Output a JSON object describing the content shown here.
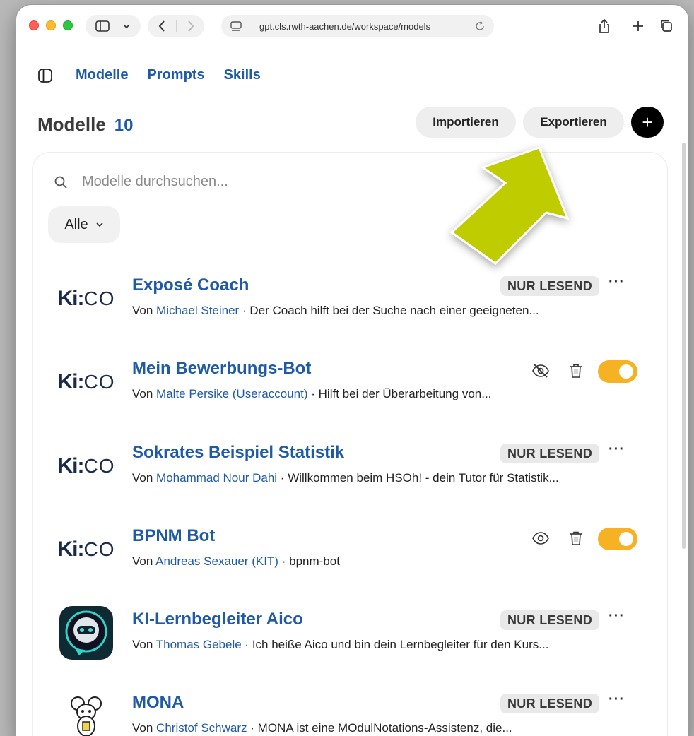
{
  "browser": {
    "url": "gpt.cls.rwth-aachen.de/workspace/models"
  },
  "tabs": [
    {
      "label": "Modelle"
    },
    {
      "label": "Prompts"
    },
    {
      "label": "Skills"
    }
  ],
  "header": {
    "title": "Modelle",
    "count": "10",
    "import_label": "Importieren",
    "export_label": "Exportieren",
    "add_label": "+"
  },
  "search": {
    "placeholder": "Modelle durchsuchen..."
  },
  "filter": {
    "selected": "Alle"
  },
  "models": [
    {
      "name": "Exposé Coach",
      "by": "Von",
      "author": "Michael Steiner",
      "sep": "·",
      "description": "Der Coach hilft bei der Suche nach einer geeigneten...",
      "badge": "NUR LESEND",
      "logo": "kico-logo"
    },
    {
      "name": "Mein Bewerbungs-Bot",
      "by": "Von",
      "author": "Malte Persike (Useraccount)",
      "sep": "·",
      "description": "Hilft bei der Überarbeitung von...",
      "logo": "kico-logo",
      "visibility_icon": "eye-slash-icon",
      "enabled": true
    },
    {
      "name": "Sokrates Beispiel Statistik",
      "by": "Von",
      "author": "Mohammad Nour Dahi",
      "sep": "·",
      "description": "Willkommen beim HSOh! - dein Tutor für Statistik...",
      "badge": "NUR LESEND",
      "logo": "kico-logo"
    },
    {
      "name": "BPNM Bot",
      "by": "Von",
      "author": "Andreas Sexauer (KIT)",
      "sep": "·",
      "description": "bpnm-bot",
      "logo": "kico-logo",
      "visibility_icon": "eye-icon",
      "enabled": true
    },
    {
      "name": "KI-Lernbegleiter Aico",
      "by": "Von",
      "author": "Thomas Gebele",
      "sep": "·",
      "description": "Ich heiße Aico und bin dein Lernbegleiter für den Kurs...",
      "badge": "NUR LESEND",
      "logo": "robot-avatar"
    },
    {
      "name": "MONA",
      "by": "Von",
      "author": "Christof Schwarz",
      "sep": "·",
      "description": "MONA ist eine MOdulNotations-Assistenz, die...",
      "badge": "NUR LESEND",
      "logo": "mouse-avatar"
    }
  ],
  "kico": {
    "bold": "Ki:",
    "light": "CO"
  },
  "more_label": "···",
  "colors": {
    "link_blue": "#1f5aa6",
    "toggle_on": "#f6b223",
    "arrow": "#bfcc00"
  }
}
